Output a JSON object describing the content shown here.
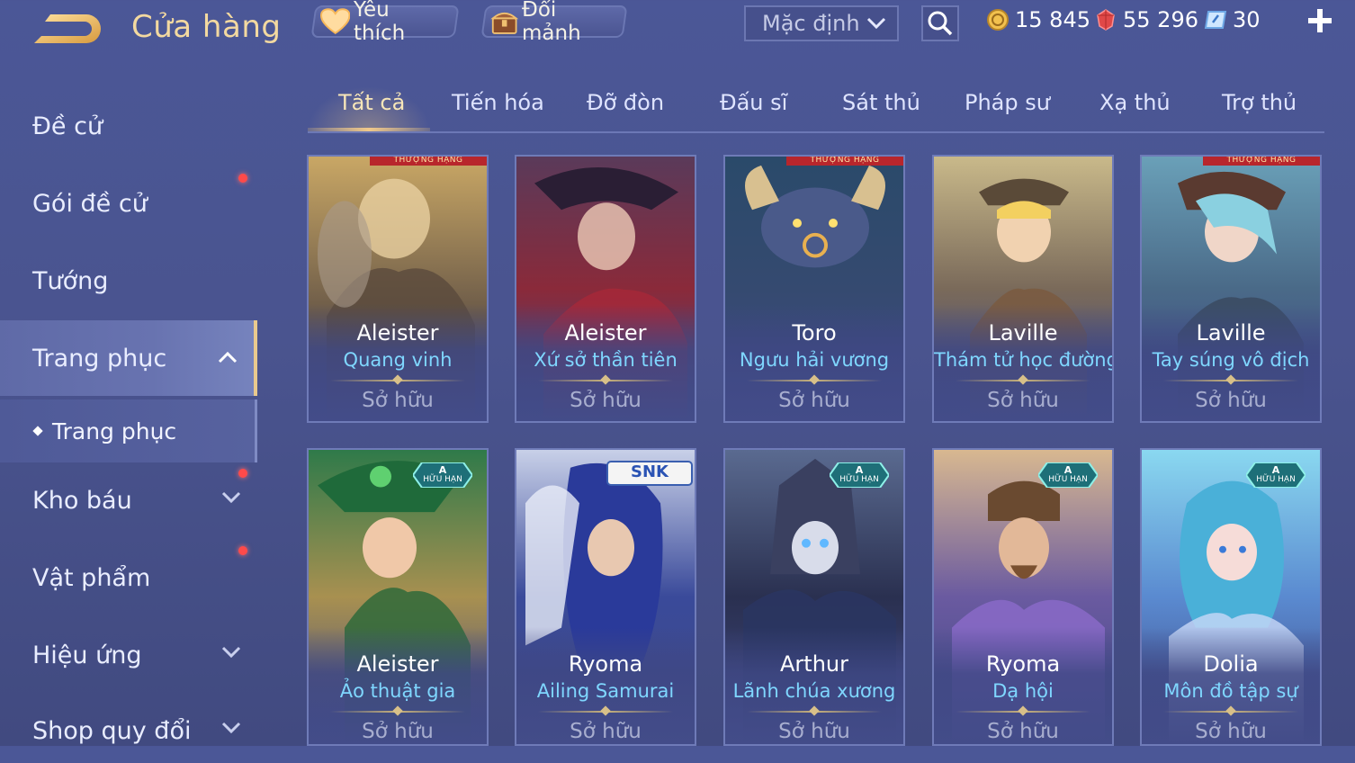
{
  "header": {
    "title": "Cửa hàng",
    "favorites_label": "Yêu thích",
    "exchange_label": "Đổi mảnh",
    "sort_label": "Mặc định",
    "gold": "15 845",
    "ruby": "55 296",
    "voucher": "30"
  },
  "sidebar": {
    "items": [
      {
        "label": "Đề cử"
      },
      {
        "label": "Gói đề cử"
      },
      {
        "label": "Tướng"
      },
      {
        "label": "Trang phục"
      },
      {
        "label": "Trang phục"
      },
      {
        "label": "Kho báu"
      },
      {
        "label": "Vật phẩm"
      },
      {
        "label": "Hiệu ứng"
      },
      {
        "label": "Shop quy đổi"
      }
    ]
  },
  "tabs": [
    "Tất cả",
    "Tiến hóa",
    "Đỡ đòn",
    "Đấu sĩ",
    "Sát thủ",
    "Pháp sư",
    "Xạ thủ",
    "Trợ thủ"
  ],
  "cards": [
    {
      "hero": "Aleister",
      "skin": "Quang vinh",
      "status": "Sở hữu",
      "ribbon": "THƯỢNG HẠNG"
    },
    {
      "hero": "Aleister",
      "skin": "Xứ sở thần tiên",
      "status": "Sở hữu"
    },
    {
      "hero": "Toro",
      "skin": "Ngưu hải vương",
      "status": "Sở hữu",
      "ribbon": "THƯỢNG HẠNG"
    },
    {
      "hero": "Laville",
      "skin": "Thám tử học đường",
      "status": "Sở hữu"
    },
    {
      "hero": "Laville",
      "skin": "Tay súng vô địch",
      "status": "Sở hữu",
      "ribbon": "THƯỢNG HẠNG"
    },
    {
      "hero": "Aleister",
      "skin": "Ảo thuật gia",
      "status": "Sở hữu",
      "badge_grade": "A",
      "badge_text": "HỮU HẠN"
    },
    {
      "hero": "Ryoma",
      "skin": "Ailing Samurai",
      "status": "Sở hữu",
      "badge_text": "SNK"
    },
    {
      "hero": "Arthur",
      "skin": "Lãnh chúa xương",
      "status": "Sở hữu",
      "badge_grade": "A",
      "badge_text": "HỮU HẠN"
    },
    {
      "hero": "Ryoma",
      "skin": "Dạ hội",
      "status": "Sở hữu",
      "badge_grade": "A",
      "badge_text": "HỮU HẠN"
    },
    {
      "hero": "Dolia",
      "skin": "Môn đồ tập sự",
      "status": "Sở hữu",
      "badge_grade": "A",
      "badge_text": "HỮU HẠN"
    }
  ],
  "colors": {
    "background": "#4a548f",
    "title_gold": "#f3d9a0",
    "skin_name": "#7fd7ff",
    "active_underline": "#f1c98a",
    "notification": "#ff4a4a"
  }
}
